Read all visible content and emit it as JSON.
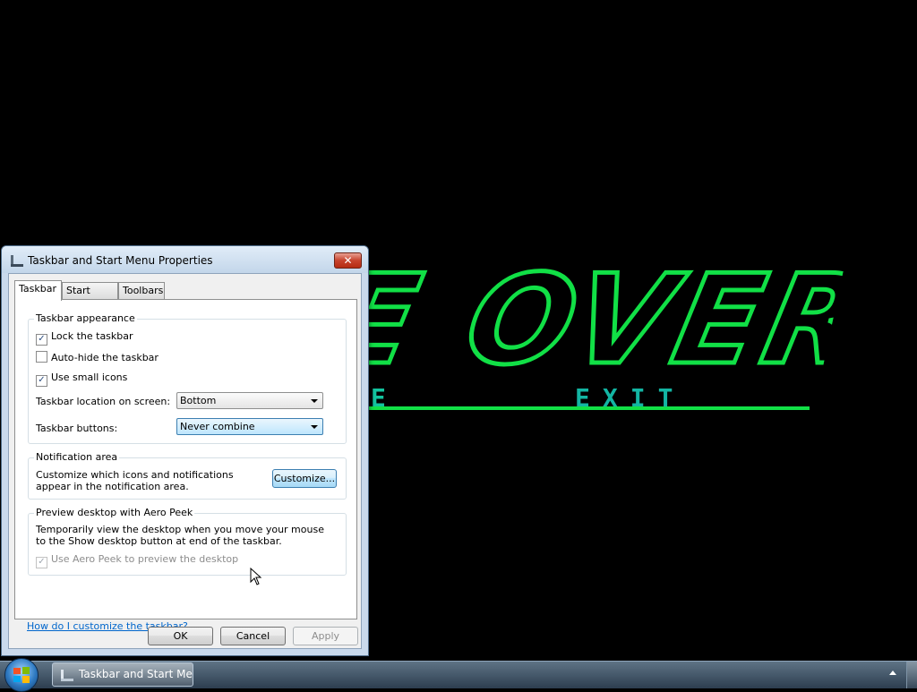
{
  "game": {
    "title_text": "E OVER",
    "menu_left": "E",
    "menu_exit": "EXIT",
    "accent_color": "#11e046"
  },
  "dialog": {
    "title": "Taskbar and Start Menu Properties",
    "close_glyph": "✕",
    "tabs": [
      "Taskbar",
      "Start Menu",
      "Toolbars"
    ],
    "appearance": {
      "title": "Taskbar appearance",
      "lock_label": "Lock the taskbar",
      "lock_checked": true,
      "autohide_label": "Auto-hide the taskbar",
      "autohide_checked": false,
      "small_icons_label": "Use small icons",
      "small_icons_checked": true,
      "location_label": "Taskbar location on screen:",
      "location_value": "Bottom",
      "buttons_label": "Taskbar buttons:",
      "buttons_value": "Never combine"
    },
    "notification": {
      "title": "Notification area",
      "desc": "Customize which icons and notifications appear in the notification area.",
      "customize_label": "Customize..."
    },
    "aero_peek": {
      "title": "Preview desktop with Aero Peek",
      "desc": "Temporarily view the desktop when you move your mouse to the Show desktop button at end of the taskbar.",
      "checkbox_label": "Use Aero Peek to preview the desktop",
      "checked": true,
      "disabled": true
    },
    "help_link": "How do I customize the taskbar?",
    "buttons": {
      "ok": "OK",
      "cancel": "Cancel",
      "apply": "Apply"
    }
  },
  "taskbar": {
    "start_icon": "windows-logo-icon",
    "task_button_label": "Taskbar and Start Me..."
  }
}
